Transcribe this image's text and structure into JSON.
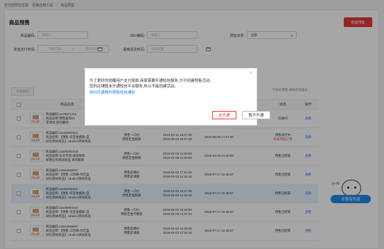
{
  "breadcrumb": {
    "prefix": "您当前所在位置:",
    "level1": "促销应用工具",
    "sep": ">",
    "level2": "商品预售"
  },
  "page": {
    "title": "商品预售",
    "new_button": "新建预售"
  },
  "filters": {
    "product_code_label": "商品编码:",
    "product_code_placeholder": "请输入",
    "sku_code_label": "SKU编码:",
    "sku_code_placeholder": "请输入",
    "presale_status_label": "预售状态:",
    "presale_status_value": "全部",
    "deposit_time_label": "定金支付时间:",
    "start_date_placeholder": "开始日期",
    "end_date_placeholder": "结束日期",
    "range_sep": "~",
    "latest_ship_label": "最晚发货时间:",
    "ship_date_placeholder": "选择日期",
    "search_button": "查询",
    "reset_button": "重置"
  },
  "toolbar": {
    "bulk_delete": "批量删除",
    "tip": "行单的预售,请联系管理员。"
  },
  "table": {
    "headers": [
      "商品信息",
      "状态",
      "操作"
    ],
    "rows": [
      {
        "code": "商品编码:1275871416",
        "name": "商品名称:预售复刻sn",
        "name2": "定测试,请勿删除",
        "type1": "",
        "type2": "",
        "time1": "",
        "time2": "",
        "created": "",
        "pay": "",
        "status": "已关闭",
        "status_extra": "",
        "op": "查看",
        "hl": false
      },
      {
        "code": "商品编码:11159494342",
        "name": "商品名称:【预售-仅定金膨胀-自",
        "name2": "动化测试商品】candice测试商品",
        "type1": "预售一口价",
        "type2": "预售定金膨胀",
        "time1": "2019-04-11 16:07:00",
        "time2": "2019-05-03 16:07:00",
        "created": "2019-05-06 17:37:00",
        "pay": "",
        "status": "预售进行中",
        "status_extra": "有未完成订单",
        "op": "查看",
        "hl": false
      },
      {
        "code": "商品编码:11569291919",
        "name": "商品名称:乐天专用,请勿修改",
        "name2": "新建立的测试商品,请勿删除",
        "type1": "预售一口价",
        "type2": "预售定金膨胀",
        "time1": "2019-04-04 21:00:00",
        "time2": "2019-04-05 21:00:00",
        "created": "2019-04-05 21:00:00",
        "pay": "",
        "status": "预售已结束",
        "status_extra": "",
        "op": "查看",
        "hl": false
      },
      {
        "code": "商品编码:12524058947",
        "name": "商品名称:【预售-三阶梯-均可自",
        "name2": "动化测试商品】candice测试商品",
        "type1": "预售前横价",
        "type2": "预售前请款",
        "time1": "2019-04-02 17:51:00",
        "time2": "2019-04-03 14:34:43",
        "created": "2018-07-17 15:45:57",
        "pay": "",
        "status": "预售已结束",
        "status_extra": "",
        "op": "查看",
        "hl": false
      },
      {
        "code": "商品编码:11159494342",
        "name": "商品名称:【预售-仅定金膨胀-自",
        "name2": "动化测试商品】candice测试商品",
        "type1": "预售一口价",
        "type2": "预售定金膨胀",
        "time1": "2019-04-02 16:27:00",
        "time2": "2019-04-03 14:34:43",
        "created": "2018-07-17 15:45:57",
        "pay": "",
        "status": "预售已结束",
        "status_extra": "",
        "op": "查看",
        "hl": true
      },
      {
        "code": "商品编码:11629994162",
        "name": "商品名称:【预售-仅定金膨胀-自",
        "name2": "动化测试商品】candice测试商品",
        "type1": "预售一口价",
        "type2": "预售定金不膨胀",
        "time1": "2019-04-02 16:26:00",
        "time2": "2019-04-03 14:37:44",
        "created": "2018-07-17 15:45:57",
        "pay": "",
        "status": "预售已结束",
        "status_extra": "",
        "op": "查看",
        "hl": false
      },
      {
        "code": "商品编码:12524058947",
        "name": "商品名称:【预售-三阶梯-均可自",
        "name2": "动化测试商品】candice测试商品",
        "type1": "预售前横价",
        "type2": "预售前请款",
        "time1": "2019-04-02 16:25:00",
        "time2": "2019-04-02 17:24:16",
        "created": "2018-07-17 15:45:57",
        "pay": "",
        "status": "预售已结束",
        "status_extra": "",
        "op": "查看",
        "hl": false
      }
    ]
  },
  "modal": {
    "line1": "为了更好的提醒用户支付尾款,商家需要开通短信服务,方可创建预售活动。",
    "line2": "您的店铺暂未开通短信平台服务,所以不能创建活动。",
    "link": "如何开通预约预售短信通知",
    "go_button": "去开通",
    "not_now_button": "暂不开通",
    "close": "×"
  },
  "cs_widget": {
    "hi": "hi~嗨",
    "label": "点我有惊喜"
  },
  "colors": {
    "accent": "#e5383b",
    "link": "#1677ff",
    "badge": "#1f8de6"
  }
}
